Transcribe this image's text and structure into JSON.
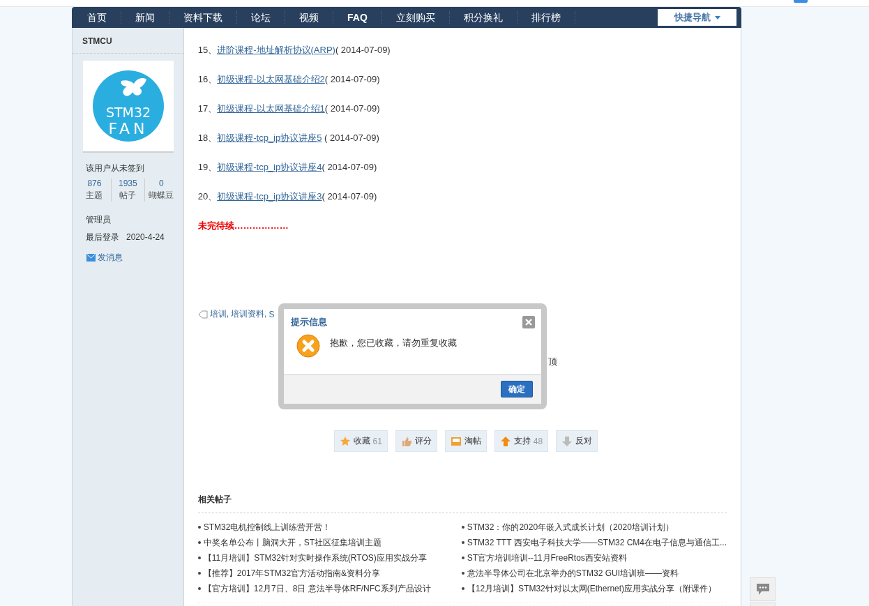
{
  "nav": {
    "items": [
      {
        "label": "首页",
        "selected": false
      },
      {
        "label": "新闻",
        "selected": false
      },
      {
        "label": "资料下载",
        "selected": false
      },
      {
        "label": "论坛",
        "selected": false
      },
      {
        "label": "视频",
        "selected": false
      },
      {
        "label": "FAQ",
        "selected": true
      },
      {
        "label": "立刻购买",
        "selected": false
      },
      {
        "label": "积分换礼",
        "selected": false
      },
      {
        "label": "排行榜",
        "selected": false
      }
    ],
    "quick_nav": "快捷导航"
  },
  "sidebar": {
    "username": "STMCU",
    "logo": [
      "STM32",
      "FAN"
    ],
    "checkin": "该用户从未签到",
    "stats": [
      {
        "value": "876",
        "label": "主题"
      },
      {
        "value": "1935",
        "label": "帖子"
      },
      {
        "value": "0",
        "label": "蝴蝶豆"
      }
    ],
    "group": "管理员",
    "last_login": {
      "label": "最后登录",
      "value": "2020-4-24"
    },
    "message": "发消息"
  },
  "content": {
    "items": [
      {
        "number": "15、",
        "title": "进阶课程-地址解析协议(ARP)",
        "date": "( 2014-07-09)"
      },
      {
        "number": "16、",
        "title": "初级课程-以太网基础介绍2",
        "date": "( 2014-07-09)"
      },
      {
        "number": "17、",
        "title": "初级课程-以太网基础介绍1",
        "date": "( 2014-07-09)"
      },
      {
        "number": "18、",
        "title": "初级课程-tcp_ip协议讲座5",
        "date": " ( 2014-07-09)"
      },
      {
        "number": "19、",
        "title": "初级课程-tcp_ip协议讲座4",
        "date": "( 2014-07-09)"
      },
      {
        "number": "20、",
        "title": "初级课程-tcp_ip协议讲座3",
        "date": "( 2014-07-09)"
      }
    ],
    "note": "未完待续………………",
    "tags": [
      "培训,",
      "培训资料,",
      "S"
    ],
    "side_text": "顶"
  },
  "dialog": {
    "title": "提示信息",
    "message": "抱歉，您已收藏，请勿重复收藏",
    "confirm": "确定"
  },
  "actions": [
    {
      "kind": "favorite",
      "label": "收藏",
      "count": "61"
    },
    {
      "kind": "rate",
      "label": "评分"
    },
    {
      "kind": "collect",
      "label": "淘帖"
    },
    {
      "kind": "support",
      "label": "支持",
      "count": "48"
    },
    {
      "kind": "oppose",
      "label": "反对"
    }
  ],
  "related": {
    "title": "相关帖子",
    "left": [
      "STM32电机控制线上训练营开营！",
      "中奖名单公布丨脑洞大开，ST社区征集培训主题",
      "【11月培训】STM32针对实时操作系统(RTOS)应用实战分享",
      "【推荐】2017年STM32官方活动指南&资料分享",
      "【官方培训】12月7日、8日 意法半导体RF/NFC系列产品设计"
    ],
    "right": [
      "STM32：你的2020年嵌入式成长计划（2020培训计划）",
      "STM32 TTT 西安电子科技大学——STM32 CM4在电子信息与通信工...",
      "ST官方培训培训--11月FreeRtos西安站资料",
      "意法半导体公司在北京举办的STM32 GUI培训班——资料",
      "【12月培训】STM32针对以太网(Ethernet)应用实战分享（附课件）"
    ]
  }
}
